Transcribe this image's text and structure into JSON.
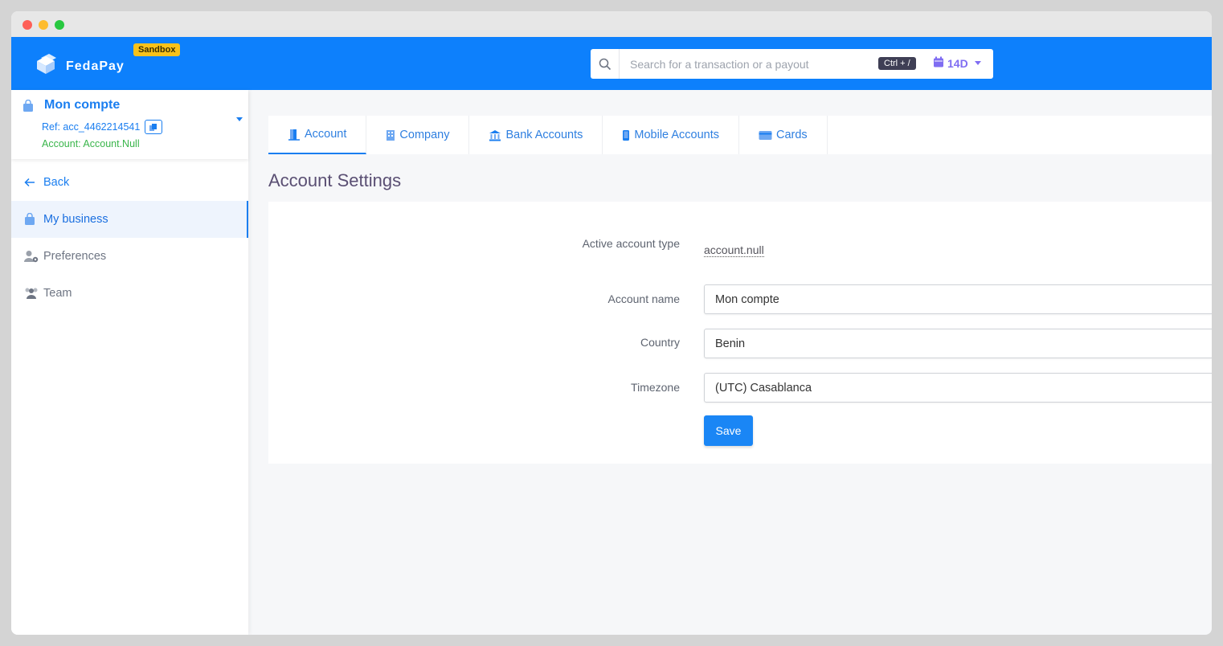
{
  "brand": {
    "name": "FedaPay",
    "badge": "Sandbox"
  },
  "search": {
    "placeholder": "Search for a transaction or a payout",
    "shortcut": "Ctrl + /",
    "period": "14D"
  },
  "account": {
    "name": "Mon compte",
    "ref": "Ref: acc_4462214541",
    "type": "Account: Account.Null"
  },
  "sidebar": {
    "back": "Back",
    "items": [
      {
        "label": "My business",
        "icon": "bag-icon",
        "active": true
      },
      {
        "label": "Preferences",
        "icon": "user-gear-icon",
        "active": false
      },
      {
        "label": "Team",
        "icon": "users-icon",
        "active": false
      }
    ]
  },
  "tabs": [
    {
      "label": "Account",
      "icon": "door-icon",
      "active": true
    },
    {
      "label": "Company",
      "icon": "building-icon",
      "active": false
    },
    {
      "label": "Bank Accounts",
      "icon": "bank-icon",
      "active": false
    },
    {
      "label": "Mobile Accounts",
      "icon": "mobile-icon",
      "active": false
    },
    {
      "label": "Cards",
      "icon": "card-icon",
      "active": false
    }
  ],
  "page": {
    "title": "Account Settings"
  },
  "form": {
    "active_type_label": "Active account type",
    "active_type_value": "account.null",
    "name_label": "Account name",
    "name_value": "Mon compte",
    "country_label": "Country",
    "country_value": "Benin",
    "timezone_label": "Timezone",
    "timezone_value": "(UTC) Casablanca",
    "save_label": "Save"
  },
  "colors": {
    "primary": "#0d80fc",
    "accent": "#1a7ef0",
    "badge": "#f9c21a",
    "success": "#39b54a",
    "period": "#7f6df2"
  }
}
